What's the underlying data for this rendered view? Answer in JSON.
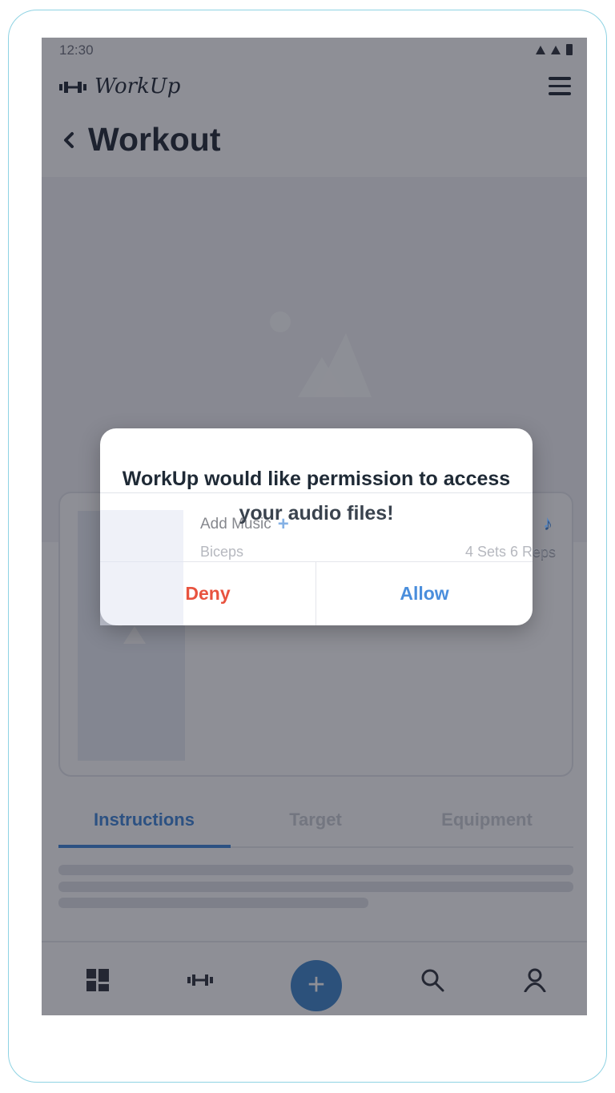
{
  "status_bar": {
    "time": "12:30"
  },
  "app": {
    "name": "WorkUp"
  },
  "page": {
    "title": "Workout"
  },
  "card": {
    "add_music_label": "Add Music",
    "muscle": "Biceps",
    "sets_reps": "4 Sets 6 Reps"
  },
  "tabs": [
    {
      "label": "Instructions",
      "active": true
    },
    {
      "label": "Target",
      "active": false
    },
    {
      "label": "Equipment",
      "active": false
    }
  ],
  "bottom_nav": {
    "items": [
      "dashboard-icon",
      "dumbbell-icon",
      "plus-icon",
      "search-icon",
      "profile-icon"
    ],
    "active": "plus-icon"
  },
  "dialog": {
    "message": "WorkUp would like permission to access your audio files!",
    "deny_label": "Deny",
    "allow_label": "Allow"
  },
  "colors": {
    "accent": "#3b82d6",
    "deny": "#e8533f",
    "allow": "#4a8edc",
    "overlay": "#1e202e"
  }
}
